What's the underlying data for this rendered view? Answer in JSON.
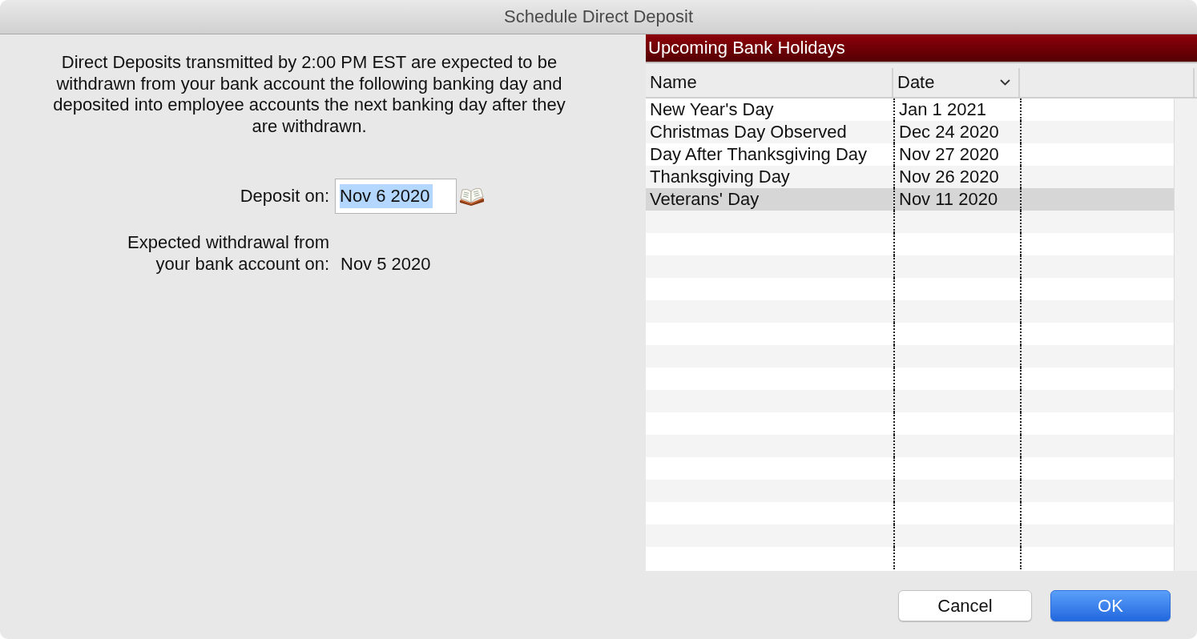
{
  "window": {
    "title": "Schedule Direct Deposit"
  },
  "notice": "Direct Deposits transmitted by 2:00 PM EST are expected to be withdrawn from your bank account the following banking day and deposited into employee accounts the next banking day after they are withdrawn.",
  "deposit": {
    "label": "Deposit on:",
    "value": "Nov 6 2020",
    "text_selected": true
  },
  "withdrawal": {
    "label": "Expected withdrawal from\nyour bank account on:",
    "value": "Nov 5 2020"
  },
  "holidays": {
    "title": "Upcoming Bank Holidays",
    "columns": [
      {
        "label": "Name",
        "sorted": false
      },
      {
        "label": "Date",
        "sorted": true
      }
    ],
    "rows": [
      {
        "name": "New Year's Day",
        "date": "Jan 1 2021",
        "selected": false
      },
      {
        "name": "Christmas Day Observed",
        "date": "Dec 24 2020",
        "selected": false
      },
      {
        "name": "Day After Thanksgiving Day",
        "date": "Nov 27 2020",
        "selected": false
      },
      {
        "name": "Thanksgiving Day",
        "date": "Nov 26 2020",
        "selected": false
      },
      {
        "name": "Veterans' Day",
        "date": "Nov 11 2020",
        "selected": true
      }
    ]
  },
  "buttons": [
    {
      "label": "Cancel",
      "kind": "secondary"
    },
    {
      "label": "OK",
      "kind": "default"
    }
  ]
}
